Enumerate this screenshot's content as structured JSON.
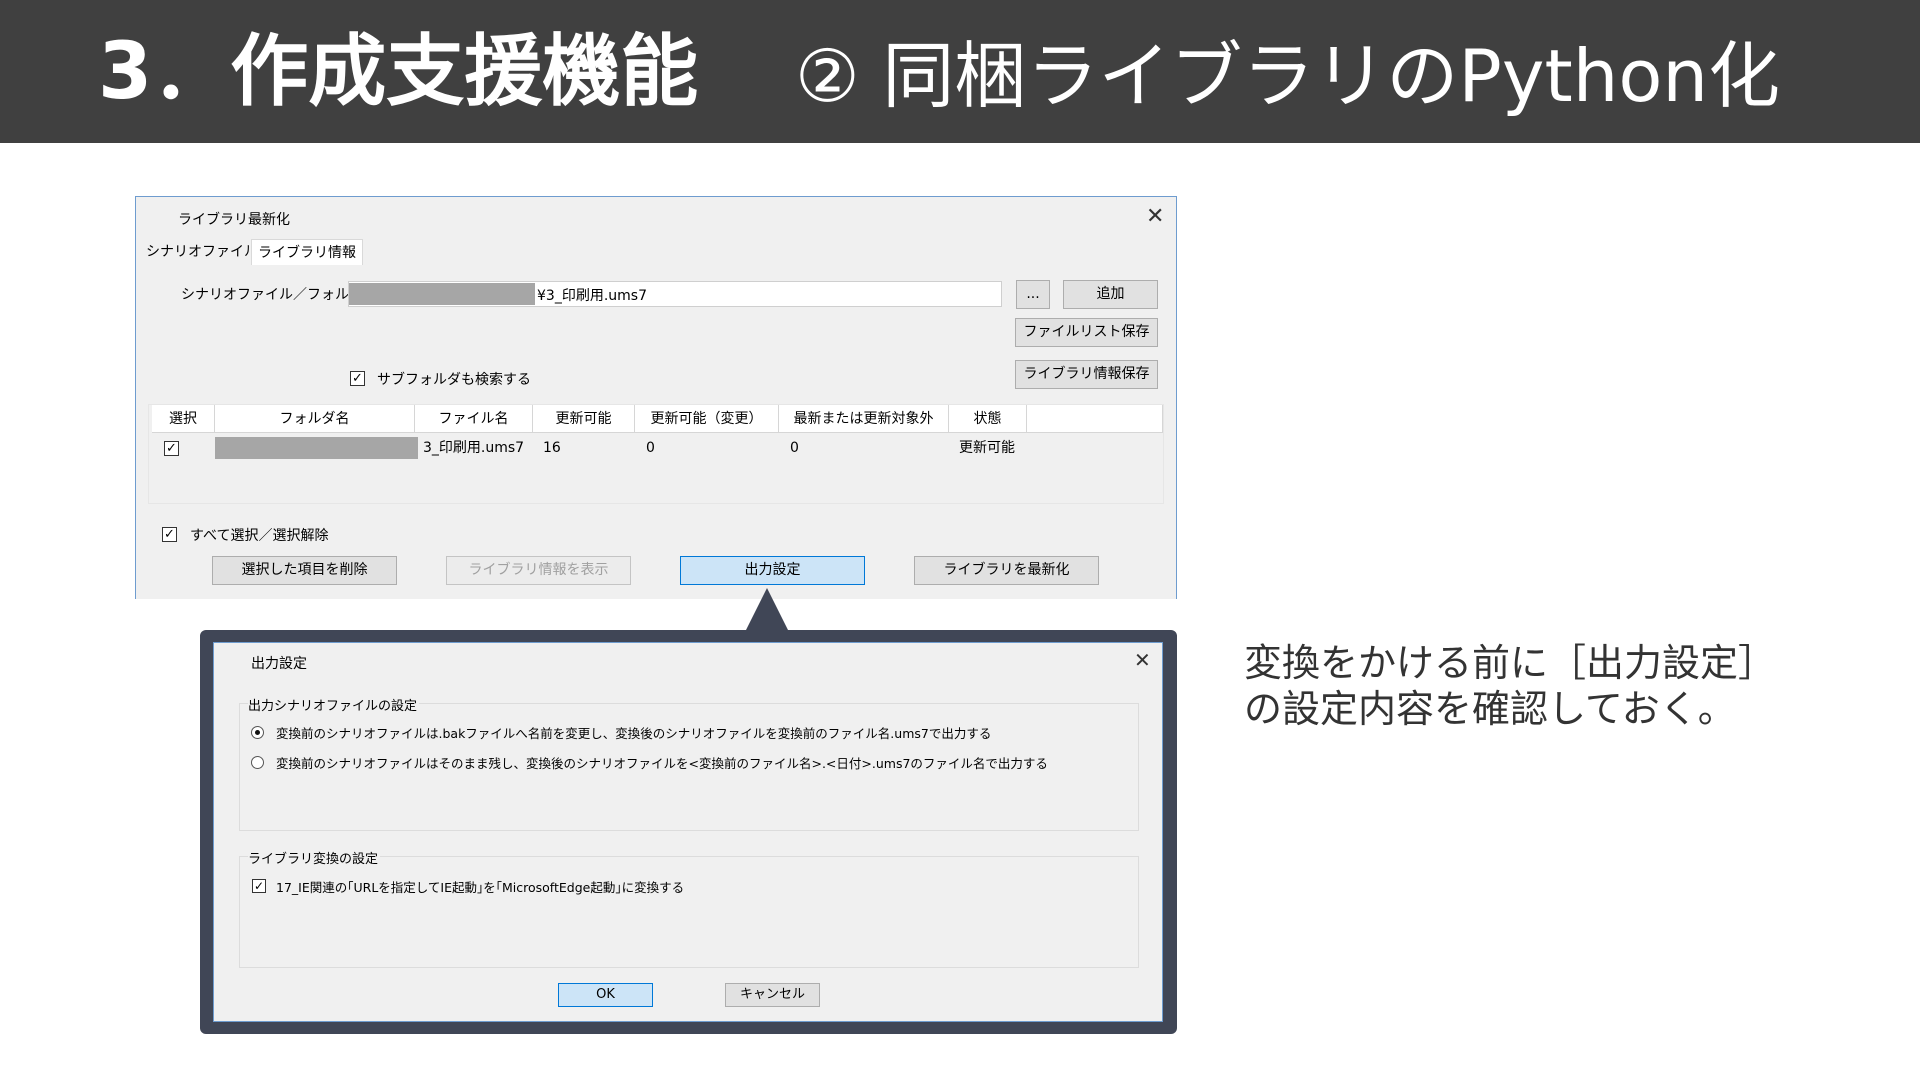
{
  "banner": {
    "main": "3．作成支援機能",
    "sub": "② 同梱ライブラリのPython化"
  },
  "dialog_update": {
    "title": "ライブラリ最新化",
    "tabs": [
      "シナリオファイル",
      "ライブラリ情報"
    ],
    "path_label": "シナリオファイル／フォルダ",
    "path_value": "¥3_印刷用.ums7",
    "browse_label": "...",
    "add_label": "追加",
    "save_list_label": "ファイルリスト保存",
    "save_info_label": "ライブラリ情報保存",
    "subfolder_label": "サブフォルダも検索する",
    "subfolder_checked": "✓",
    "columns": [
      "選択",
      "フォルダ名",
      "ファイル名",
      "更新可能",
      "更新可能（変更）",
      "最新または更新対象外",
      "状態"
    ],
    "row": {
      "checked": "✓",
      "file": "3_印刷用.ums7",
      "updatable": "16",
      "updatable_changed": "0",
      "latest_or_excluded": "0",
      "status": "更新可能"
    },
    "select_all_label": "すべて選択／選択解除",
    "select_all_checked": "✓",
    "buttons": {
      "delete": "選択した項目を削除",
      "show_info": "ライブラリ情報を表示",
      "output": "出力設定",
      "update": "ライブラリを最新化"
    }
  },
  "dialog_output": {
    "title": "出力設定",
    "group1_label": "出力シナリオファイルの設定",
    "option1": "変換前のシナリオファイルは.bakファイルへ名前を変更し、変換後のシナリオファイルを変換前のファイル名.ums7で出力する",
    "option2": "変換前のシナリオファイルはそのまま残し、変換後のシナリオファイルを<変換前のファイル名>.<日付>.ums7のファイル名で出力する",
    "group2_label": "ライブラリ変換の設定",
    "ie_option": "17_IE関連の｢URLを指定してIE起動｣を｢MicrosoftEdge起動｣に変換する",
    "ie_checked": "✓",
    "ok_label": "OK",
    "cancel_label": "キャンセル"
  },
  "note": {
    "line1": "変換をかける前に［出力設定］",
    "line2": "の設定内容を確認しておく。"
  },
  "colors": {
    "banner_bg": "#404040",
    "callout_frame": "#404656",
    "primary_button": "#cce4f7"
  }
}
